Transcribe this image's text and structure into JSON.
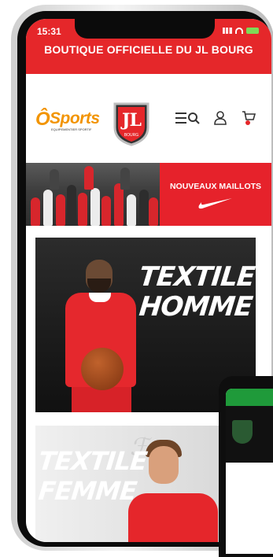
{
  "status": {
    "time": "15:31"
  },
  "banner": {
    "text": "BOUTIQUE OFFICIELLE DU JL BOURG"
  },
  "header": {
    "osports_logo": "Sports",
    "osports_tagline": "EQUIPEMENTIER SPORTIF",
    "jl_logo": "JL",
    "jl_sub": "BOURG",
    "icons": [
      "menu-icon",
      "search-icon",
      "account-icon",
      "cart-icon"
    ]
  },
  "hero": {
    "text": "NOUVEAUX MAILLOTS"
  },
  "cards": [
    {
      "line1": "TEXTILE",
      "line2": "HOMME"
    },
    {
      "line1": "TEXTILE",
      "line2": "FEMME"
    }
  ],
  "colors": {
    "brand_red": "#e5272a",
    "osports_orange": "#f29400"
  }
}
